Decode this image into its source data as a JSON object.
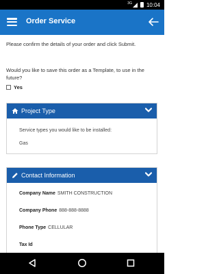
{
  "status_bar": {
    "signal_label": "3G",
    "time": "10:04"
  },
  "app_bar": {
    "title": "Order Service"
  },
  "intro_text": "Please confirm the details of your order and click Submit.",
  "template_question": "Would you like to save this order as a Template, to use in the future?",
  "template_checkbox_label": "Yes",
  "project_type_panel": {
    "title": "Project Type",
    "service_types_label": "Service types you would like to be installed:",
    "service_type_value": "Gas"
  },
  "contact_panel": {
    "title": "Contact Information",
    "fields": [
      {
        "label": "Company Name",
        "value": "SMITH CONSTRUCTION"
      },
      {
        "label": "Company Phone",
        "value": "888-888-8888"
      },
      {
        "label": "Phone Type",
        "value": "CELLULAR"
      },
      {
        "label": "Tax Id",
        "value": ""
      }
    ]
  },
  "colors": {
    "app_bar": "#1a74c7",
    "panel_header": "#1a5eab"
  },
  "icons": [
    "menu-icon",
    "back-arrow-icon",
    "home-icon",
    "pencil-icon",
    "chevron-down-icon",
    "nav-back-icon",
    "nav-home-icon",
    "nav-recents-icon"
  ]
}
